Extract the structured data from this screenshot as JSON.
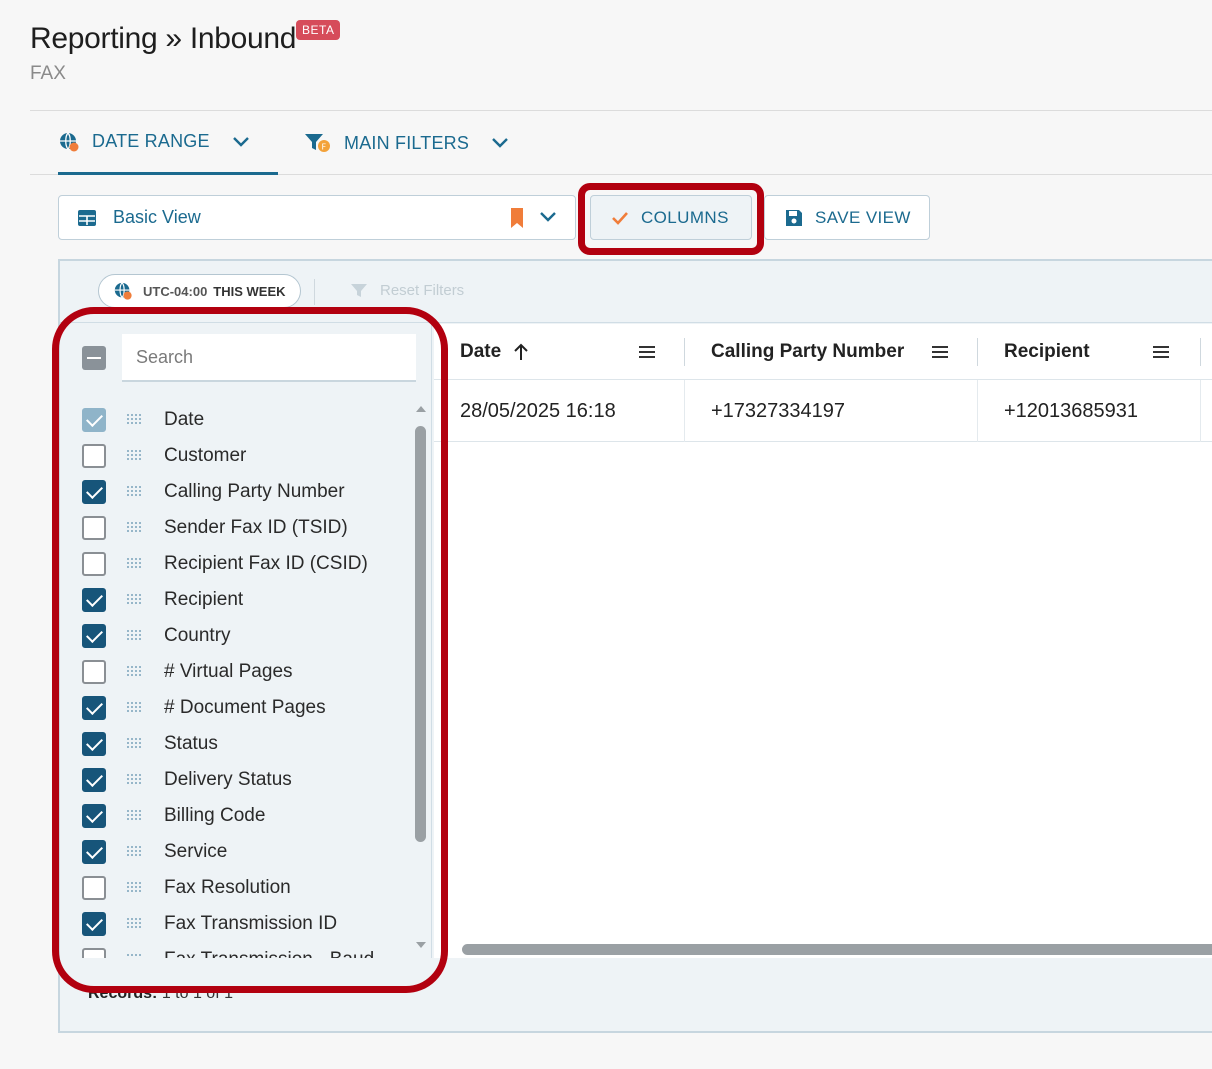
{
  "header": {
    "title": "Reporting » Inbound",
    "badge": "BETA",
    "subtitle": "FAX"
  },
  "tabs": [
    {
      "label": "DATE RANGE",
      "icon": "globe-icon",
      "active": true
    },
    {
      "label": "MAIN FILTERS",
      "icon": "filter-icon",
      "active": false
    }
  ],
  "toolbar": {
    "view_label": "Basic View",
    "columns_label": "COLUMNS",
    "save_view_label": "SAVE VIEW"
  },
  "filters": {
    "timezone": "UTC-04:00",
    "range": "THIS WEEK",
    "reset_label": "Reset Filters"
  },
  "column_panel": {
    "search_placeholder": "Search",
    "items": [
      {
        "label": "Date",
        "checked": true
      },
      {
        "label": "Customer",
        "checked": false
      },
      {
        "label": "Calling Party Number",
        "checked": true
      },
      {
        "label": "Sender Fax ID (TSID)",
        "checked": false
      },
      {
        "label": "Recipient Fax ID (CSID)",
        "checked": false
      },
      {
        "label": "Recipient",
        "checked": true
      },
      {
        "label": "Country",
        "checked": true
      },
      {
        "label": "# Virtual Pages",
        "checked": false
      },
      {
        "label": "# Document Pages",
        "checked": true
      },
      {
        "label": "Status",
        "checked": true
      },
      {
        "label": "Delivery Status",
        "checked": true
      },
      {
        "label": "Billing Code",
        "checked": true
      },
      {
        "label": "Service",
        "checked": true
      },
      {
        "label": "Fax Resolution",
        "checked": false
      },
      {
        "label": "Fax Transmission ID",
        "checked": true
      },
      {
        "label": "Fax Transmission - Baud",
        "checked": false
      }
    ]
  },
  "table": {
    "columns": [
      "Date",
      "Calling Party Number",
      "Recipient"
    ],
    "rows": [
      [
        "28/05/2025 16:18",
        "+17327334197",
        "+12013685931"
      ]
    ]
  },
  "footer": {
    "records_label": "Records:",
    "records_value": "1 to 1 of 1"
  },
  "colors": {
    "accent": "#1b6a8f",
    "checkbox_checked": "#17557a",
    "badge": "#d64c5a",
    "highlight": "#b2000f"
  }
}
